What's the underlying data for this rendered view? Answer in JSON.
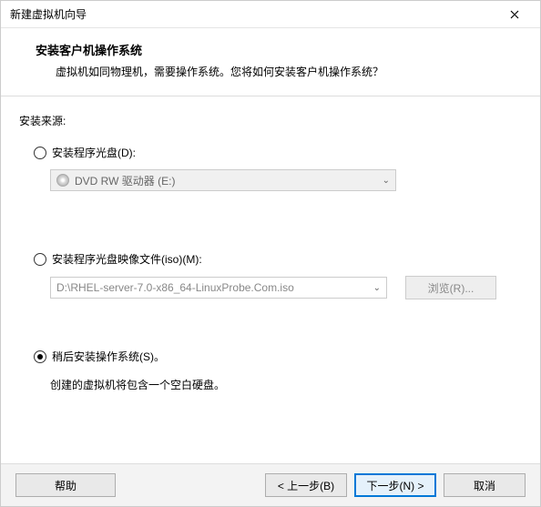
{
  "titlebar": {
    "title": "新建虚拟机向导"
  },
  "header": {
    "title": "安装客户机操作系统",
    "subtitle": "虚拟机如同物理机，需要操作系统。您将如何安装客户机操作系统？"
  },
  "source_label": "安装来源:",
  "options": {
    "disc": {
      "label": "安装程序光盘(D):",
      "dropdown_text": "DVD RW 驱动器 (E:)"
    },
    "iso": {
      "label": "安装程序光盘映像文件(iso)(M):",
      "path": "D:\\RHEL-server-7.0-x86_64-LinuxProbe.Com.iso",
      "browse": "浏览(R)..."
    },
    "later": {
      "label": "稍后安装操作系统(S)。",
      "note": "创建的虚拟机将包含一个空白硬盘。"
    }
  },
  "footer": {
    "help": "帮助",
    "back": "< 上一步(B)",
    "next": "下一步(N) >",
    "cancel": "取消"
  }
}
